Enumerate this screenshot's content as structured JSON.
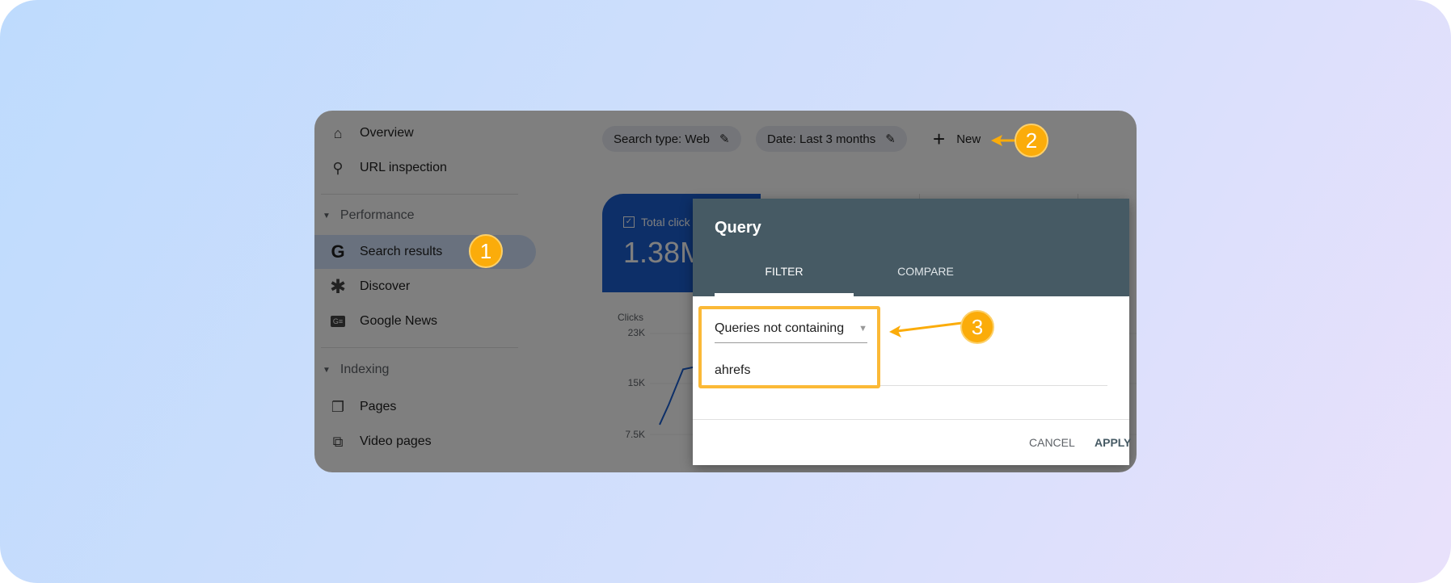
{
  "sidebar": {
    "items": [
      {
        "label": "Overview",
        "icon": "home-icon"
      },
      {
        "label": "URL inspection",
        "icon": "search-icon"
      }
    ],
    "performance": {
      "label": "Performance",
      "items": [
        {
          "label": "Search results",
          "icon": "google-g-icon",
          "active": true
        },
        {
          "label": "Discover",
          "icon": "asterisk-icon"
        },
        {
          "label": "Google News",
          "icon": "google-news-icon"
        }
      ]
    },
    "indexing": {
      "label": "Indexing",
      "items": [
        {
          "label": "Pages",
          "icon": "pages-icon"
        },
        {
          "label": "Video pages",
          "icon": "video-pages-icon"
        }
      ]
    }
  },
  "filters": {
    "search_type": "Search type: Web",
    "date": "Date: Last 3 months",
    "new_label": "New"
  },
  "metric_card": {
    "label": "Total click",
    "value": "1.38M",
    "color": "#1a5fd0"
  },
  "chart": {
    "ylabel": "Clicks",
    "yticks": [
      "23K",
      "15K",
      "7.5K"
    ],
    "values": [
      9000,
      12000,
      17500,
      17800,
      17500
    ]
  },
  "dialog": {
    "title": "Query",
    "tabs": [
      {
        "label": "FILTER",
        "active": true
      },
      {
        "label": "COMPARE"
      }
    ],
    "filter_type": "Queries not containing",
    "filter_value": "ahrefs",
    "cancel_label": "CANCEL",
    "apply_label": "APPLY",
    "header_color": "#465a64"
  },
  "annotations": {
    "badge1": "1",
    "badge2": "2",
    "badge3": "3",
    "color": "#fbac0a"
  }
}
